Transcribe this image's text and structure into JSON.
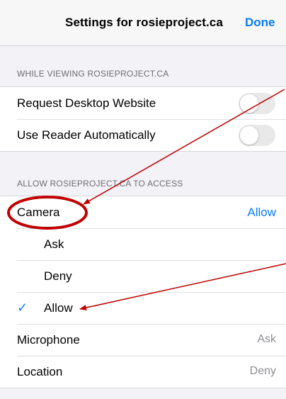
{
  "header": {
    "title": "Settings for rosieproject.ca",
    "done_label": "Done"
  },
  "sections": {
    "viewing_header": "WHILE VIEWING ROSIEPROJECT.CA",
    "access_header": "ALLOW ROSIEPROJECT.CA TO ACCESS"
  },
  "viewing": {
    "request_desktop_label": "Request Desktop Website",
    "request_desktop_on": false,
    "reader_label": "Use Reader Automatically",
    "reader_on": false
  },
  "access": {
    "camera_label": "Camera",
    "camera_value": "Allow",
    "options": {
      "ask": "Ask",
      "deny": "Deny",
      "allow": "Allow",
      "selected": "Allow"
    },
    "check_icon": "✓",
    "microphone_label": "Microphone",
    "microphone_value": "Ask",
    "location_label": "Location",
    "location_value": "Deny"
  },
  "colors": {
    "accent": "#0a7cff",
    "annotation_red": "#c00000",
    "background": "#f2f2f7"
  },
  "icons": {
    "check": "checkmark-icon",
    "annotation_circle": "red-circle-annotation",
    "annotation_arrows": "red-arrow-annotation"
  }
}
